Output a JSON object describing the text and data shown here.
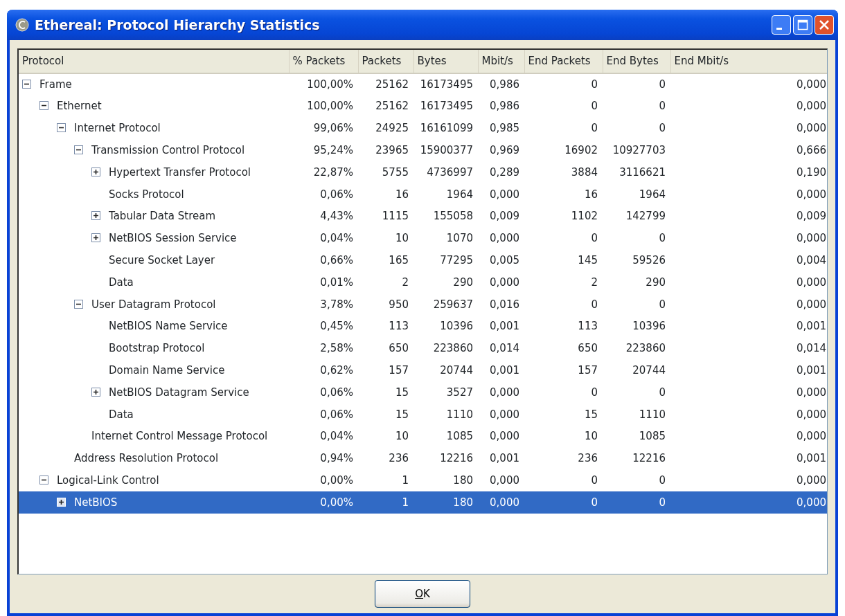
{
  "window": {
    "title": "Ethereal: Protocol Hierarchy Statistics"
  },
  "table": {
    "columns": [
      "Protocol",
      "% Packets",
      "Packets",
      "Bytes",
      "Mbit/s",
      "End Packets",
      "End Bytes",
      "End Mbit/s"
    ],
    "rows": [
      {
        "protocol": "Frame",
        "expanded": true,
        "selected": false,
        "values": [
          "100,00%",
          "25162",
          "16173495",
          "0,986",
          "0",
          "0",
          "0,000"
        ],
        "children": [
          {
            "protocol": "Ethernet",
            "expanded": true,
            "selected": false,
            "values": [
              "100,00%",
              "25162",
              "16173495",
              "0,986",
              "0",
              "0",
              "0,000"
            ],
            "children": [
              {
                "protocol": "Internet Protocol",
                "expanded": true,
                "selected": false,
                "values": [
                  "99,06%",
                  "24925",
                  "16161099",
                  "0,985",
                  "0",
                  "0",
                  "0,000"
                ],
                "children": [
                  {
                    "protocol": "Transmission Control Protocol",
                    "expanded": true,
                    "selected": false,
                    "values": [
                      "95,24%",
                      "23965",
                      "15900377",
                      "0,969",
                      "16902",
                      "10927703",
                      "0,666"
                    ],
                    "children": [
                      {
                        "protocol": "Hypertext Transfer Protocol",
                        "expanded": false,
                        "selected": false,
                        "values": [
                          "22,87%",
                          "5755",
                          "4736997",
                          "0,289",
                          "3884",
                          "3116621",
                          "0,190"
                        ]
                      },
                      {
                        "protocol": "Socks Protocol",
                        "selected": false,
                        "values": [
                          "0,06%",
                          "16",
                          "1964",
                          "0,000",
                          "16",
                          "1964",
                          "0,000"
                        ]
                      },
                      {
                        "protocol": "Tabular Data Stream",
                        "expanded": false,
                        "selected": false,
                        "values": [
                          "4,43%",
                          "1115",
                          "155058",
                          "0,009",
                          "1102",
                          "142799",
                          "0,009"
                        ]
                      },
                      {
                        "protocol": "NetBIOS Session Service",
                        "expanded": false,
                        "selected": false,
                        "values": [
                          "0,04%",
                          "10",
                          "1070",
                          "0,000",
                          "0",
                          "0",
                          "0,000"
                        ]
                      },
                      {
                        "protocol": "Secure Socket Layer",
                        "selected": false,
                        "values": [
                          "0,66%",
                          "165",
                          "77295",
                          "0,005",
                          "145",
                          "59526",
                          "0,004"
                        ]
                      },
                      {
                        "protocol": "Data",
                        "selected": false,
                        "values": [
                          "0,01%",
                          "2",
                          "290",
                          "0,000",
                          "2",
                          "290",
                          "0,000"
                        ]
                      }
                    ]
                  },
                  {
                    "protocol": "User Datagram Protocol",
                    "expanded": true,
                    "selected": false,
                    "values": [
                      "3,78%",
                      "950",
                      "259637",
                      "0,016",
                      "0",
                      "0",
                      "0,000"
                    ],
                    "children": [
                      {
                        "protocol": "NetBIOS Name Service",
                        "selected": false,
                        "values": [
                          "0,45%",
                          "113",
                          "10396",
                          "0,001",
                          "113",
                          "10396",
                          "0,001"
                        ]
                      },
                      {
                        "protocol": "Bootstrap Protocol",
                        "selected": false,
                        "values": [
                          "2,58%",
                          "650",
                          "223860",
                          "0,014",
                          "650",
                          "223860",
                          "0,014"
                        ]
                      },
                      {
                        "protocol": "Domain Name Service",
                        "selected": false,
                        "values": [
                          "0,62%",
                          "157",
                          "20744",
                          "0,001",
                          "157",
                          "20744",
                          "0,001"
                        ]
                      },
                      {
                        "protocol": "NetBIOS Datagram Service",
                        "expanded": false,
                        "selected": false,
                        "values": [
                          "0,06%",
                          "15",
                          "3527",
                          "0,000",
                          "0",
                          "0",
                          "0,000"
                        ]
                      },
                      {
                        "protocol": "Data",
                        "selected": false,
                        "values": [
                          "0,06%",
                          "15",
                          "1110",
                          "0,000",
                          "15",
                          "1110",
                          "0,000"
                        ]
                      }
                    ]
                  },
                  {
                    "protocol": "Internet Control Message Protocol",
                    "selected": false,
                    "values": [
                      "0,04%",
                      "10",
                      "1085",
                      "0,000",
                      "10",
                      "1085",
                      "0,000"
                    ]
                  }
                ]
              },
              {
                "protocol": "Address Resolution Protocol",
                "selected": false,
                "values": [
                  "0,94%",
                  "236",
                  "12216",
                  "0,001",
                  "236",
                  "12216",
                  "0,001"
                ]
              }
            ]
          },
          {
            "protocol": "Logical-Link Control",
            "expanded": true,
            "selected": false,
            "values": [
              "0,00%",
              "1",
              "180",
              "0,000",
              "0",
              "0",
              "0,000"
            ],
            "children": [
              {
                "protocol": "NetBIOS",
                "expanded": false,
                "selected": true,
                "values": [
                  "0,00%",
                  "1",
                  "180",
                  "0,000",
                  "0",
                  "0",
                  "0,000"
                ]
              }
            ]
          }
        ]
      }
    ]
  },
  "buttons": [
    {
      "label": "OK"
    }
  ]
}
